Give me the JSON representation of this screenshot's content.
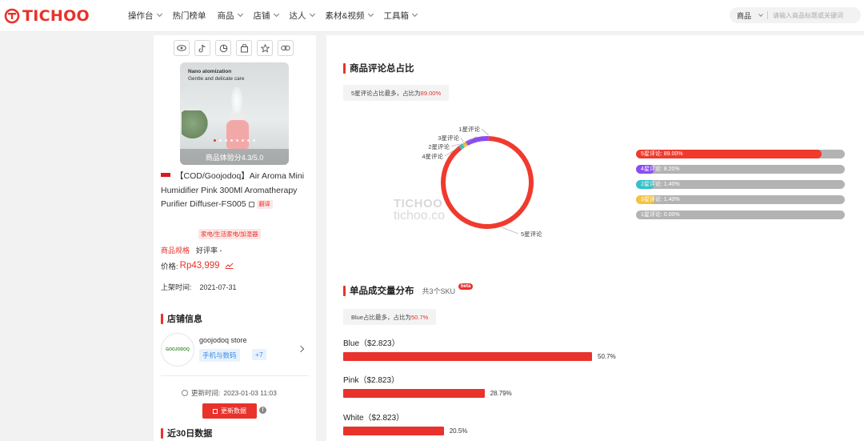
{
  "brand": {
    "name": "TICHOO",
    "color": "#e8322b"
  },
  "nav": [
    {
      "label": "操作台",
      "dropdown": true
    },
    {
      "label": "热门榜单",
      "dropdown": false
    },
    {
      "label": "商品",
      "dropdown": true
    },
    {
      "label": "店铺",
      "dropdown": true
    },
    {
      "label": "达人",
      "dropdown": true
    },
    {
      "label": "素材&视频",
      "dropdown": true
    },
    {
      "label": "工具箱",
      "dropdown": true
    }
  ],
  "search": {
    "category": "商品",
    "placeholder": "请输入商品标题或关键词"
  },
  "product": {
    "image_caption_1": "Nano atomization",
    "image_caption_2": "Gentle and delicate care",
    "score": "商品体验分4.3/5.0",
    "title": "【COD/Goojodoq】Air Aroma Mini Humidifier Pink 300Ml Aromatherapy Purifier Diffuser-FS005",
    "translate": "翻译",
    "category": "家电/生活家电/加湿器",
    "spec_link": "商品规格",
    "rating": "好评率 -",
    "price_label": "价格:",
    "price": "Rp43,999",
    "listed_label": "上架时间:",
    "listed_date": "2021-07-31"
  },
  "store": {
    "section_title": "店铺信息",
    "logo_text": "GOOJODOQ",
    "name": "goojodoq store",
    "tag": "手机与数码",
    "tag_more": "+7",
    "updated_label": "更新时间:",
    "updated_time": "2023-01-03 11:03",
    "update_button": "更新数据"
  },
  "last30": {
    "title": "近30日数据"
  },
  "reviews": {
    "title": "商品评论总占比",
    "summary_prefix": "5星评论占比最多，占比为",
    "summary_pct": "89.00%",
    "callouts": [
      "1星评论",
      "3星评论",
      "2星评论",
      "4星评论",
      "5星评论"
    ],
    "watermark_1": "TICHOO",
    "watermark_2": "tichoo.co",
    "legend": [
      {
        "label": "5星评论: 89.00%",
        "value": 89.0,
        "color": "#f03a2e"
      },
      {
        "label": "4星评论: 8.20%",
        "value": 8.2,
        "color": "#8a4df0"
      },
      {
        "label": "2星评论: 1.40%",
        "value": 1.4,
        "color": "#33c1c9"
      },
      {
        "label": "3星评论: 1.40%",
        "value": 1.4,
        "color": "#f5c342"
      },
      {
        "label": "1星评论: 0.00%",
        "value": 0.0,
        "color": "#4a7df0"
      }
    ]
  },
  "sku": {
    "title": "单品成交量分布",
    "count_text": "共3个SKU",
    "beta": "beta",
    "summary_prefix": "Blue占比最多，占比为",
    "summary_pct": "50.7%",
    "items": [
      {
        "label": "Blue（$2.823）",
        "value": 50.7,
        "pct": "50.7%"
      },
      {
        "label": "Pink（$2.823）",
        "value": 28.79,
        "pct": "28.79%"
      },
      {
        "label": "White（$2.823）",
        "value": 20.5,
        "pct": "20.5%"
      }
    ]
  },
  "chart_data": {
    "type": "pie",
    "categories": [
      "5星评论",
      "4星评论",
      "2星评论",
      "3星评论",
      "1星评论"
    ],
    "values": [
      89.0,
      8.2,
      1.4,
      1.4,
      0.0
    ],
    "title": "商品评论总占比"
  }
}
